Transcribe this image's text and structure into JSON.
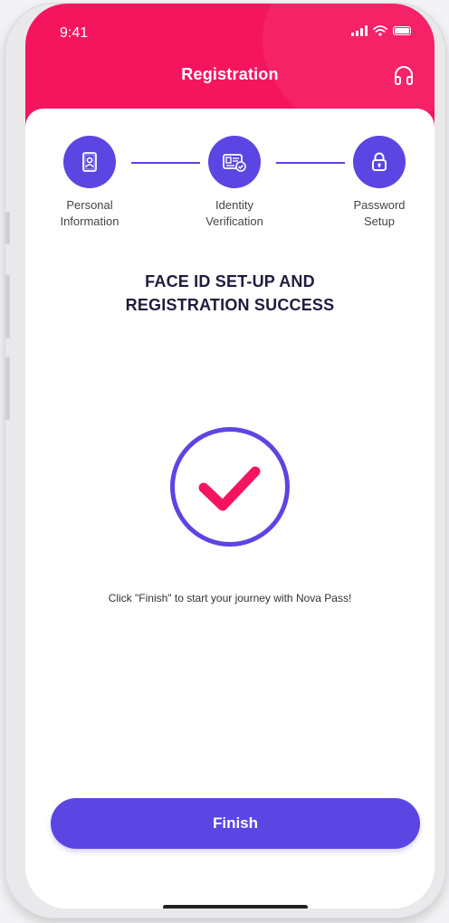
{
  "status_bar": {
    "time": "9:41"
  },
  "header": {
    "title": "Registration"
  },
  "steps": [
    {
      "label_line1": "Personal",
      "label_line2": "Information"
    },
    {
      "label_line1": "Identity",
      "label_line2": "Verification"
    },
    {
      "label_line1": "Password",
      "label_line2": "Setup"
    }
  ],
  "main": {
    "heading_line1": "FACE ID SET-UP AND",
    "heading_line2": "REGISTRATION SUCCESS",
    "message": "Click \"Finish\" to start your journey with Nova Pass!"
  },
  "footer": {
    "finish_label": "Finish"
  },
  "colors": {
    "header": "#f5155e",
    "accent": "#5b45e3",
    "check": "#f5155e"
  },
  "icons": [
    "document-person-icon",
    "id-card-check-icon",
    "lock-icon",
    "headset-icon",
    "checkmark-icon"
  ]
}
